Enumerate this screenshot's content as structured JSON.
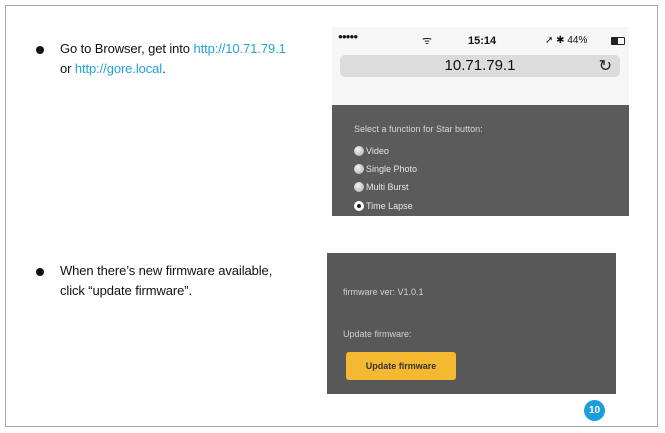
{
  "steps": [
    {
      "line1_prefix": "Go to Browser, get into ",
      "line1_link": "http://10.71.79.1",
      "line2_link": "http://gore.local",
      "line2_prefix": "or ",
      "line2_suffix": "."
    },
    {
      "line1": "When there’s new firmware available,",
      "line2": "click “update firmware”."
    }
  ],
  "phone": {
    "signal": "●●●●●",
    "wifi": "ᯤ",
    "time": "15:14",
    "status_right": "➚ ✱ 44%",
    "url": "10.71.79.1",
    "reload_icon": "↻",
    "prompt": "Select a function for Star button:",
    "options": [
      {
        "label": "Video",
        "selected": false
      },
      {
        "label": "Single Photo",
        "selected": false
      },
      {
        "label": "Multi Burst",
        "selected": false
      },
      {
        "label": "Time Lapse",
        "selected": true
      }
    ]
  },
  "firmware": {
    "version": "firmware ver: V1.0.1",
    "update_label": "Update firmware:",
    "button": "Update firmware"
  },
  "page_number": "10",
  "colors": {
    "link": "#1fa3d9",
    "button": "#f5b931",
    "page_badge": "#1a9edc",
    "panel": "#5b5b5b"
  }
}
